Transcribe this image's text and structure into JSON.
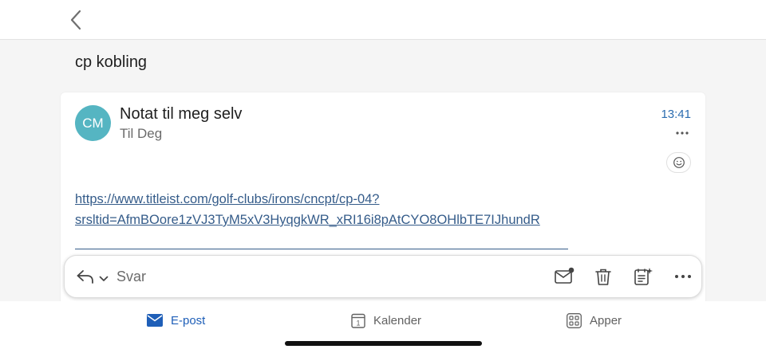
{
  "thread": {
    "subject": "cp kobling"
  },
  "message": {
    "avatar_initials": "CM",
    "sender": "Notat til meg selv",
    "recipient": "Til Deg",
    "time": "13:41",
    "body_link_line1": "https://www.titleist.com/golf-clubs/irons/cncpt/cp-04?",
    "body_link_line2": "srsltid=AfmBOore1zVJ3TyM5xV3HyqgkWR_xRI16i8pAtCYO8OHlbTE7IJhundR"
  },
  "reply_bar": {
    "label": "Svar"
  },
  "bottom_nav": {
    "items": [
      {
        "label": "E-post",
        "active": true
      },
      {
        "label": "Kalender",
        "active": false
      },
      {
        "label": "Apper",
        "active": false
      }
    ]
  },
  "colors": {
    "accent": "#2b6cb0",
    "avatar": "#55b5c2",
    "link": "#355c8a",
    "nav_active": "#1f5fb8",
    "nav_inactive": "#616161"
  },
  "icons": {
    "back": "chevron-left-icon",
    "more": "more-horizontal-icon",
    "react": "smiley-icon",
    "reply": "reply-icon",
    "reply_options": "chevron-down-icon",
    "mark_unread": "mail-unread-icon",
    "delete": "trash-icon",
    "summarize": "sparkle-list-icon",
    "overflow": "more-horizontal-icon",
    "mail": "mail-icon",
    "calendar": "calendar-icon",
    "apps": "apps-grid-icon"
  }
}
